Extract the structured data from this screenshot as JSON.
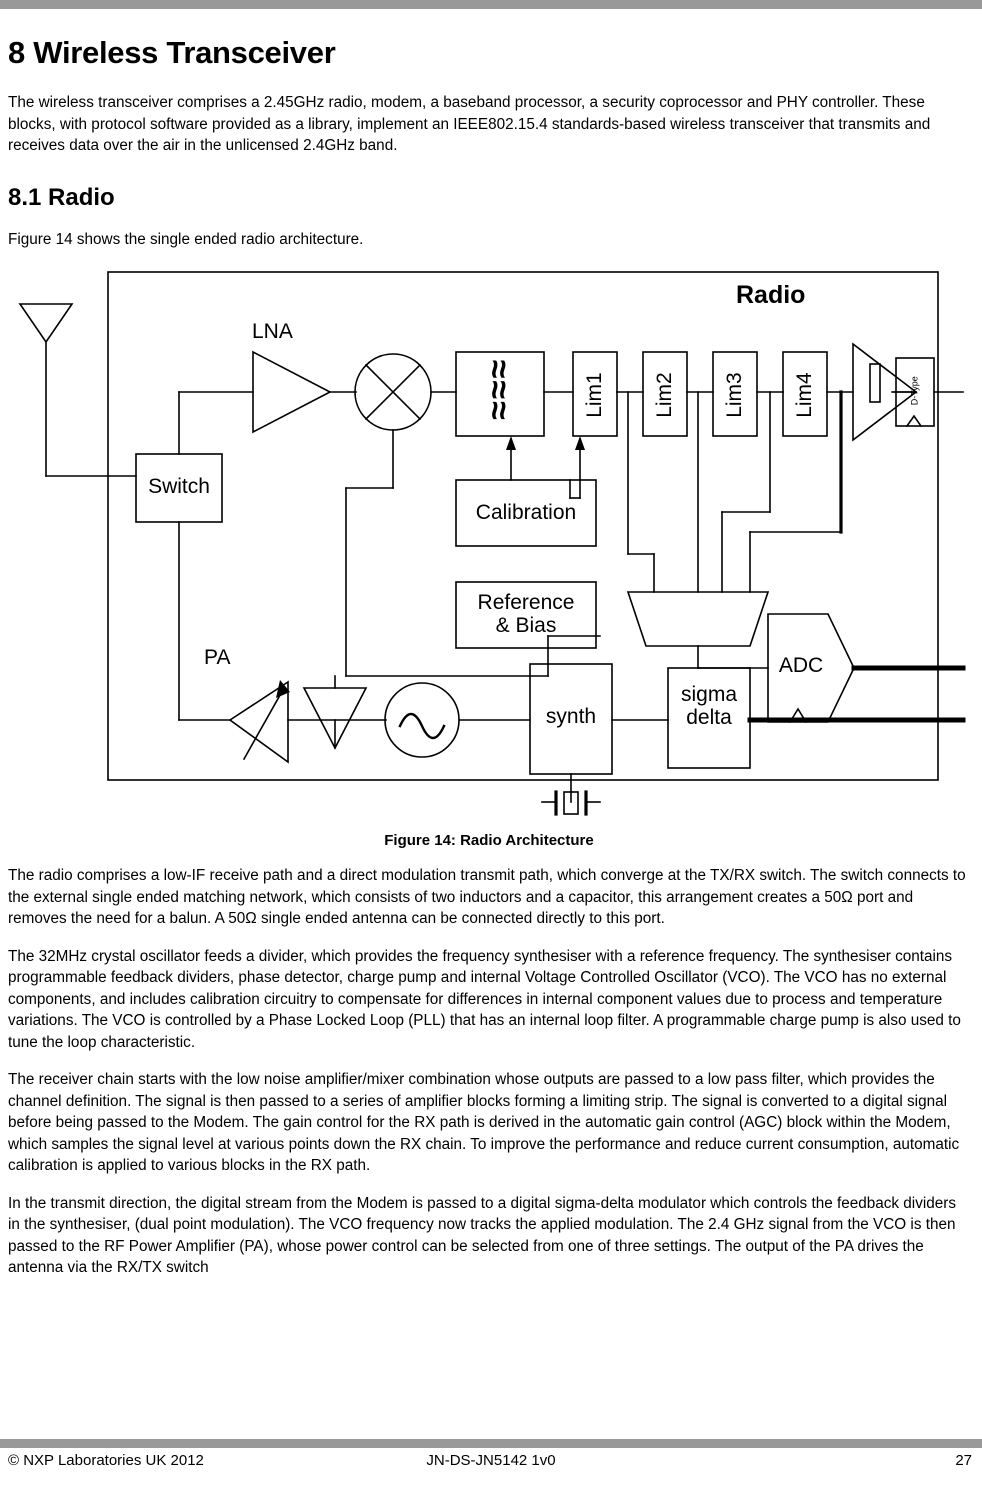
{
  "document": {
    "chapter_number_title": "8 Wireless Transceiver",
    "intro_paragraph": "The wireless transceiver comprises a 2.45GHz radio, modem, a baseband processor, a security coprocessor and PHY controller.  These blocks, with protocol software provided as a library, implement an IEEE802.15.4 standards-based wireless transceiver that transmits and receives data over the air in the unlicensed 2.4GHz band.",
    "section_title": "8.1 Radio",
    "section_intro": "Figure 14 shows the single ended radio architecture.",
    "figure_caption": "Figure 14: Radio Architecture",
    "paragraphs": [
      "The radio comprises a low-IF receive path and a direct modulation transmit path, which converge at the TX/RX switch.  The switch connects to the external single ended matching network, which consists of two inductors and a capacitor, this arrangement creates a 50Ω port and removes the need for a balun.  A 50Ω single ended antenna can be connected directly to this port.",
      "The 32MHz crystal oscillator feeds a divider, which provides the frequency synthesiser with a reference frequency.  The synthesiser contains programmable feedback dividers, phase detector, charge pump and internal Voltage Controlled Oscillator (VCO).  The VCO has no external components, and includes calibration circuitry to compensate for differences in internal component values due to process and temperature variations.  The VCO is controlled by a Phase Locked Loop (PLL) that has an internal loop filter.  A programmable charge pump is also used to tune the loop characteristic.",
      "The receiver chain starts with the low noise amplifier/mixer combination whose outputs are passed to a low pass filter, which provides the channel definition.  The signal is then passed to a series of amplifier blocks forming a limiting strip.  The signal is converted to a digital signal before being passed to the Modem.  The gain control for the RX path is derived in the automatic gain control (AGC) block within the Modem, which samples the signal level at various points down the RX chain.  To improve the performance and reduce current consumption, automatic calibration is applied to various blocks in the RX path.",
      "In the transmit direction, the digital stream from the Modem is passed to a digital sigma-delta modulator which controls the feedback dividers in the synthesiser, (dual point modulation).  The VCO frequency now tracks the applied modulation.  The 2.4 GHz signal from the VCO is then passed to the RF Power Amplifier (PA), whose power control can be selected from one of three settings.  The output of the PA drives the antenna via the RX/TX switch"
    ]
  },
  "figure": {
    "title": "Radio",
    "labels": {
      "lna": "LNA",
      "pa": "PA",
      "switch": "Switch",
      "filter_symbol": "≈≈≈",
      "lim1": "Lim1",
      "lim2": "Lim2",
      "lim3": "Lim3",
      "lim4": "Lim4",
      "dtype": "D-Type",
      "calibration": "Calibration",
      "reference_bias": "Reference\n& Bias",
      "adc": "ADC",
      "synth": "synth",
      "sigma_delta": "sigma\ndelta"
    },
    "colors": {
      "line": "#000000",
      "rule_bar": "#999999",
      "text": "#000000"
    }
  },
  "footer": {
    "copyright": "© NXP Laboratories UK 2012",
    "doc_id": "JN-DS-JN5142 1v0",
    "page_number": "27"
  }
}
